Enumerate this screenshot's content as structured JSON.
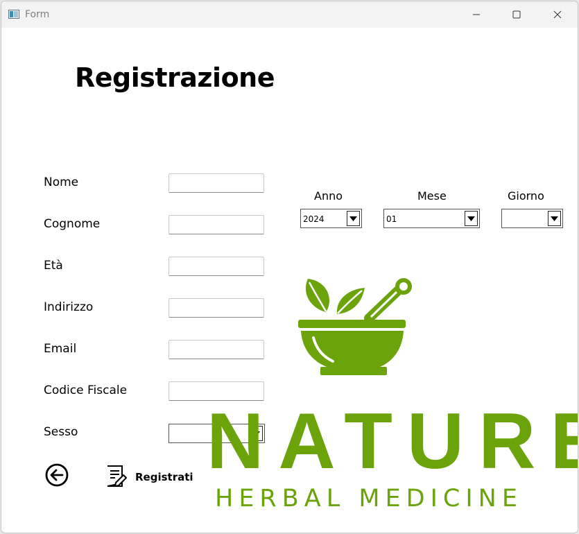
{
  "window": {
    "title": "Form",
    "controls": [
      "minimize",
      "maximize",
      "close"
    ]
  },
  "heading": "Registrazione",
  "form": {
    "fields": [
      {
        "label": "Nome",
        "value": ""
      },
      {
        "label": "Cognome",
        "value": ""
      },
      {
        "label": "Età",
        "value": ""
      },
      {
        "label": "Indirizzo",
        "value": ""
      },
      {
        "label": "Email",
        "value": ""
      },
      {
        "label": "Codice Fiscale",
        "value": ""
      }
    ],
    "sesso": {
      "label": "Sesso",
      "selected": ""
    }
  },
  "birthdate": {
    "anno": {
      "label": "Anno",
      "selected": "2024"
    },
    "mese": {
      "label": "Mese",
      "selected": "01"
    },
    "giorno": {
      "label": "Giorno",
      "selected": ""
    }
  },
  "actions": {
    "back_icon": "arrow-left-circle-icon",
    "register_icon": "document-edit-icon",
    "register_label": "Registrati"
  },
  "logo": {
    "icon": "mortar-pestle-leaves-icon",
    "brand": "NATURE",
    "tagline": "HERBAL MEDICINE",
    "color": "#6aa30a"
  }
}
